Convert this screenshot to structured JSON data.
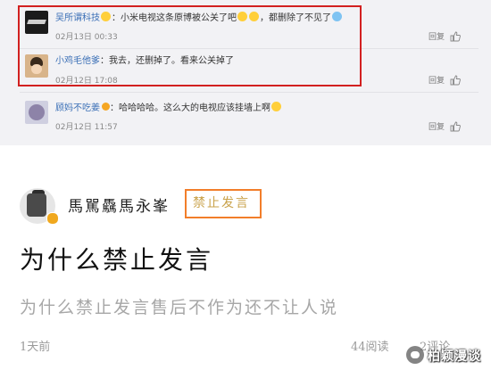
{
  "comments": [
    {
      "username": "吴所谓科技",
      "text_a": "：小米电视这条原博被公关了吧",
      "text_b": "，都删除了不见了",
      "time": "02月13日 00:33",
      "reply_label": "回复",
      "icons": [
        "fire-emoji",
        "smile-emoji",
        "smile-emoji",
        "crying-laugh-emoji"
      ]
    },
    {
      "username": "小鸡毛他爹",
      "text": "：我去，还删掉了。看来公关掉了",
      "time": "02月12日 17:08",
      "reply_label": "回复"
    },
    {
      "username": "顾妈不吃姜",
      "text": "：哈哈哈哈。这么大的电视应该挂墙上啊",
      "time": "02月12日 11:57",
      "reply_label": "回复",
      "icons": [
        "verified-badge",
        "smile-emoji"
      ]
    }
  ],
  "post": {
    "author": "馬駡驫馬永峯",
    "tag": "禁止发言",
    "title": "为什么禁止发言",
    "body": "为什么禁止发言售后不作为还不让人说",
    "time": "1天前",
    "reads": "44阅读",
    "comments": "2评论"
  },
  "watermark": {
    "text": "柏颖漫谈"
  },
  "colors": {
    "highlight_red": "#d22020",
    "highlight_orange": "#f27e2a",
    "username_blue": "#3a6fb6",
    "tag_gold": "#c9a24a"
  }
}
